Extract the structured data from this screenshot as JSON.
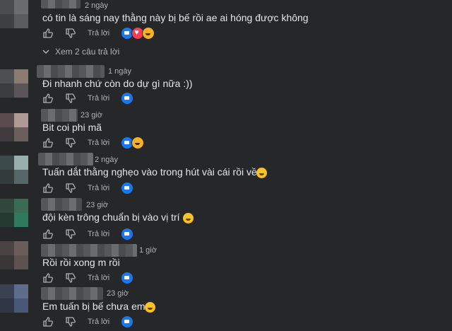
{
  "reply_label": "Trả lời",
  "see_more": "Xem 2 câu trả lời",
  "comments": [
    {
      "time": "2 ngày",
      "text": "có tin là sáng nay thằng này bị bế rồi ae ai hóng được không"
    },
    {
      "time": "1 ngày",
      "text": "Đi nhanh chứ còn do dự gì nữa :))"
    },
    {
      "time": "23 giờ",
      "text": "Bit coi phi mã"
    },
    {
      "time": "2 ngày",
      "text": "Tuấn dắt thằng nghẹo vào trong hút vài cái rồi về"
    },
    {
      "time": "23 giờ",
      "text": "đội kèn trông chuẩn bị vào vị trí"
    },
    {
      "time": "1 giờ",
      "text": "Rồi rồi xong m rồi"
    },
    {
      "time": "23 giờ",
      "text": "Em tuấn bị bế chưa em"
    }
  ],
  "colors": {
    "background": "#252728",
    "text": "#e4e6eb",
    "muted": "#b0b3b8",
    "like_blue": "#1877f2",
    "love_red": "#f33e58",
    "haha_yellow": "#f7b125"
  }
}
